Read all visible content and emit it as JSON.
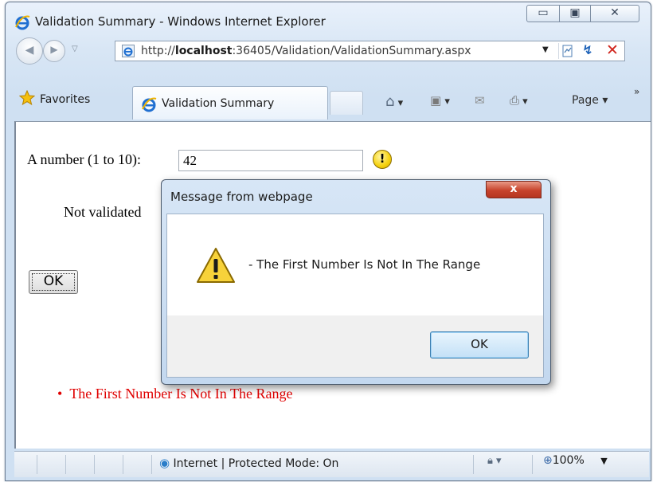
{
  "window": {
    "title": "Validation Summary - Windows Internet Explorer"
  },
  "address_bar": {
    "url_prefix": "http://",
    "url_host": "localhost",
    "url_rest": ":36405/Validation/ValidationSummary.aspx"
  },
  "favorites_bar": {
    "favorites_label": "Favorites"
  },
  "tabs": [
    {
      "label": "Validation Summary"
    }
  ],
  "command_bar": {
    "page_label": "Page ▾",
    "overflow_label": "»"
  },
  "page": {
    "number_label": "A number (1 to 10):",
    "number_value": "42",
    "error_indicator": "!",
    "not_validated_text": "Not validated",
    "ok_button_label": "OK",
    "summary_items": [
      "The First Number Is Not In The Range"
    ]
  },
  "dialog": {
    "title": "Message from webpage",
    "close_label": "x",
    "message": "- The First Number Is Not In The Range",
    "ok_label": "OK"
  },
  "status_bar": {
    "zone_text": "Internet | Protected Mode: On",
    "zoom_text": "100%"
  },
  "colors": {
    "error_text": "#e00000",
    "dialog_frame": "#c3d8ef"
  }
}
